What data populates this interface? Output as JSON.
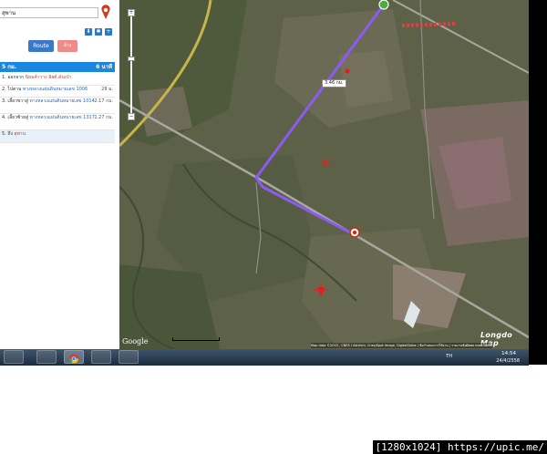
{
  "search": {
    "value": "สุพาน"
  },
  "toolbar": {
    "route_label": "Route",
    "clear_label": "ล้าง"
  },
  "route": {
    "header_left": "5 กม.",
    "header_right": "6 นาที",
    "steps": [
      {
        "text_a": "1. ออกจาก ",
        "text_b": "นิยมค้าวาง ลิสต์.ดันเบ้า",
        "dist": ""
      },
      {
        "text_a": "2. ไปตาม ",
        "text_b": "ทางหลวงแผ่นดินหมายเลข 1006",
        "dist": "28 ม."
      },
      {
        "text_a": "3. เลี้ยวขวาสู่ ",
        "text_b": "ทางหลวงแผ่นดินหมายเลข 1014",
        "dist": "2.17 กม."
      },
      {
        "text_a": "4. เลี้ยวซ้ายสู่ ",
        "text_b": "ทางหลวงแผ่นดินหมายเลข 1317",
        "dist": "1.27 กม."
      },
      {
        "text_a": "5. ถึง ",
        "text_b": "สุพาน",
        "dist": ""
      }
    ]
  },
  "map": {
    "distance_label": "3.46 กม.",
    "brand": "Longdo Map",
    "google": "Google",
    "copyright": "Map data ©2015 , CNES / Astrium, Cnes/Spot Image, DigitalGlobe | ข้อกำหนดการใช้งาน | รายงานข้อผิดพลาดของแผนที่"
  },
  "taskbar": {
    "lang": "TH",
    "time": "14:54",
    "date": "24/4/2558"
  },
  "watermark": "[1280x1024] https://upic.me/",
  "colors": {
    "route": "#8a5cf0",
    "accent": "#1a86e0"
  }
}
